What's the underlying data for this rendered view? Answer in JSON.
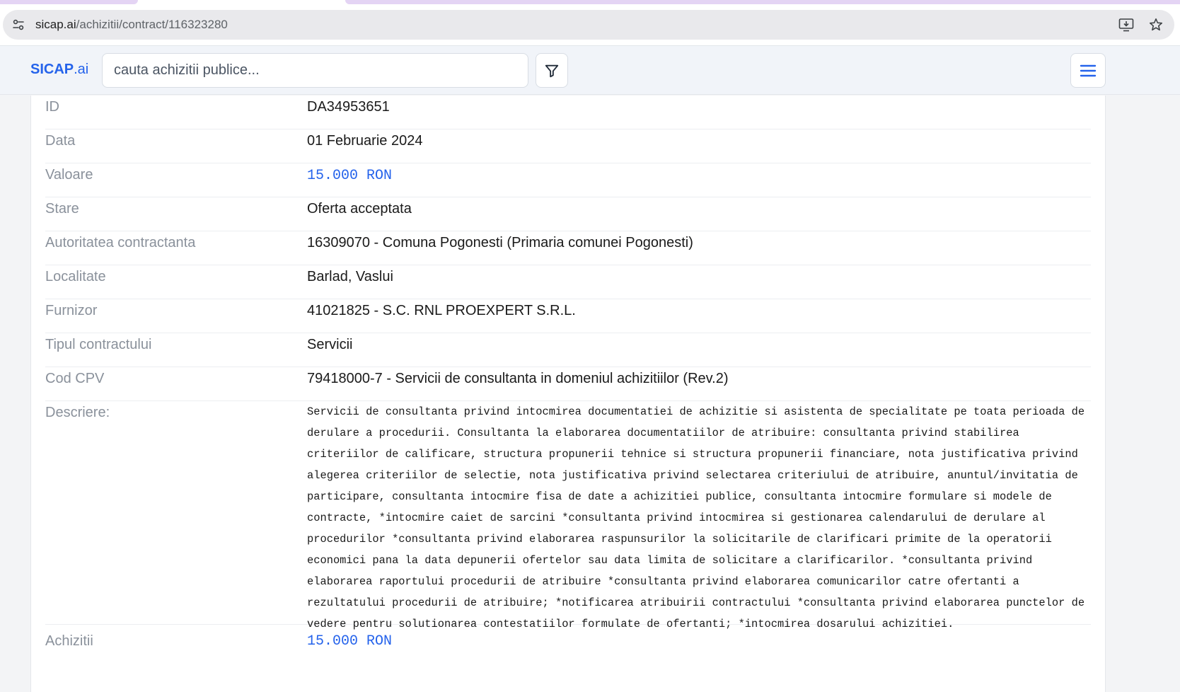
{
  "browser": {
    "url_host": "sicap.ai",
    "url_path": "/achizitii/contract/116323280"
  },
  "header": {
    "logo_bold": "SICAP",
    "logo_suffix": ".ai",
    "search_placeholder": "cauta achizitii publice..."
  },
  "details": {
    "id": {
      "label": "ID",
      "value": "DA34953651"
    },
    "data": {
      "label": "Data",
      "value": "01 Februarie 2024"
    },
    "valoare": {
      "label": "Valoare",
      "value": "15.000 RON"
    },
    "stare": {
      "label": "Stare",
      "value": "Oferta acceptata"
    },
    "autoritate": {
      "label": "Autoritatea contractanta",
      "value": "16309070 - Comuna Pogonesti (Primaria comunei Pogonesti)"
    },
    "localitate": {
      "label": "Localitate",
      "value": "Barlad, Vaslui"
    },
    "furnizor": {
      "label": "Furnizor",
      "value": "41021825 - S.C. RNL PROEXPERT S.R.L."
    },
    "tip": {
      "label": "Tipul contractului",
      "value": "Servicii"
    },
    "cpv": {
      "label": "Cod CPV",
      "value": "79418000-7 - Servicii de consultanta in domeniul achizitiilor (Rev.2)"
    },
    "descriere": {
      "label": "Descriere:",
      "value": "Servicii de consultanta privind intocmirea documentatiei de achizitie si asistenta de specialitate pe toata perioada de derulare a procedurii. Consultanta la elaborarea documentatiilor de atribuire: consultanta privind stabilirea criteriilor de calificare, structura propunerii tehnice si structura propunerii financiare, nota justificativa privind alegerea criteriilor de selectie, nota justificativa privind selectarea criteriului de atribuire, anuntul/invitatia de participare, consultanta intocmire fisa de date a achizitiei publice, consultanta intocmire formulare si modele de contracte, *intocmire caiet de sarcini *consultanta privind intocmirea si gestionarea calendarului de derulare al procedurilor *consultanta privind elaborarea raspunsurilor la solicitarile de clarificari primite de la operatorii economici pana la data depunerii ofertelor sau data limita de solicitare a clarificarilor. *consultanta privind elaborarea raportului procedurii de atribuire *consultanta privind elaborarea comunicarilor catre ofertanti a rezultatului procedurii de atribuire; *notificarea atribuirii contractului *consultanta privind elaborarea punctelor de vedere pentru solutionarea contestatiilor formulate de ofertanti; *intocmirea dosarului achizitiei."
    },
    "achizitii": {
      "label": "Achizitii",
      "value": "15.000 RON"
    }
  }
}
